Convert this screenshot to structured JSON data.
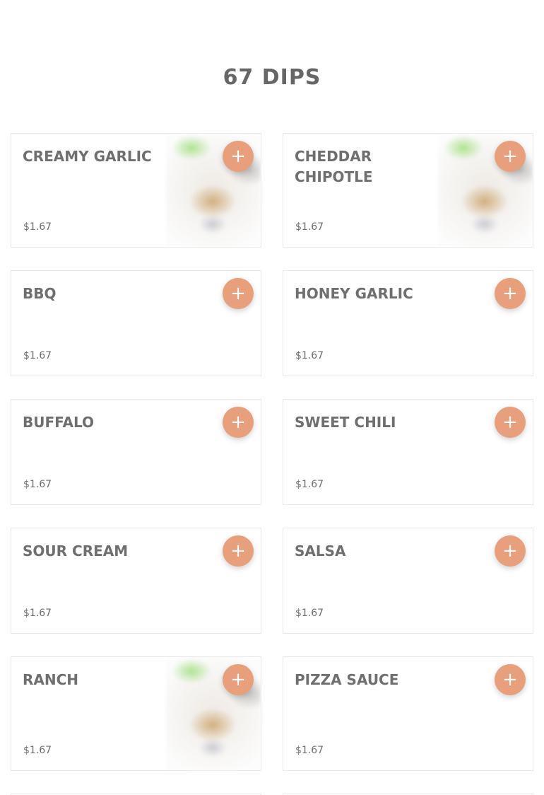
{
  "section": {
    "title": "67 DIPS"
  },
  "add_icon": "plus-icon",
  "accent_color": "#e89f7b",
  "items": [
    {
      "name": "CREAMY GARLIC",
      "price": "$1.67",
      "add_label": "+"
    },
    {
      "name": "CHEDDAR CHIPOTLE",
      "price": "$1.67",
      "add_label": "+"
    },
    {
      "name": "BBQ",
      "price": "$1.67",
      "add_label": "+"
    },
    {
      "name": "HONEY GARLIC",
      "price": "$1.67",
      "add_label": "+"
    },
    {
      "name": "BUFFALO",
      "price": "$1.67",
      "add_label": "+"
    },
    {
      "name": "SWEET CHILI",
      "price": "$1.67",
      "add_label": "+"
    },
    {
      "name": "SOUR CREAM",
      "price": "$1.67",
      "add_label": "+"
    },
    {
      "name": "SALSA",
      "price": "$1.67",
      "add_label": "+"
    },
    {
      "name": "RANCH",
      "price": "$1.67",
      "add_label": "+"
    },
    {
      "name": "PIZZA SAUCE",
      "price": "$1.67",
      "add_label": "+"
    }
  ]
}
